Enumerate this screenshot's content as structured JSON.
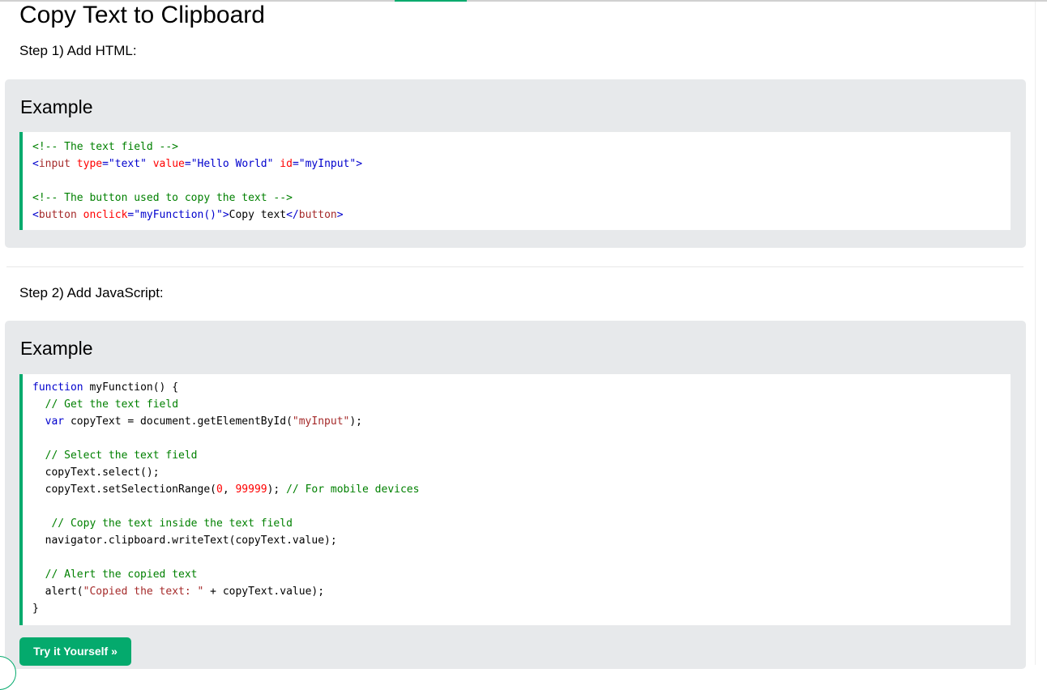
{
  "page": {
    "title": "Copy Text to Clipboard",
    "step1": "Step 1) Add HTML:",
    "step2": "Step 2) Add JavaScript:"
  },
  "examples": [
    {
      "title": "Example",
      "lines": [
        [
          {
            "t": "<!-- The text field -->",
            "c": "cmt"
          }
        ],
        [
          {
            "t": "<",
            "c": "tagb"
          },
          {
            "t": "input",
            "c": "tag"
          },
          {
            "t": " type",
            "c": "attr"
          },
          {
            "t": "=\"text\"",
            "c": "val"
          },
          {
            "t": " value",
            "c": "attr"
          },
          {
            "t": "=\"Hello World\"",
            "c": "val"
          },
          {
            "t": " id",
            "c": "attr"
          },
          {
            "t": "=\"myInput\"",
            "c": "val"
          },
          {
            "t": ">",
            "c": "tagb"
          }
        ],
        [],
        [
          {
            "t": "<!-- The button used to copy the text -->",
            "c": "cmt"
          }
        ],
        [
          {
            "t": "<",
            "c": "tagb"
          },
          {
            "t": "button",
            "c": "tag"
          },
          {
            "t": " onclick",
            "c": "attr"
          },
          {
            "t": "=\"myFunction()\"",
            "c": "val"
          },
          {
            "t": ">",
            "c": "tagb"
          },
          {
            "t": "Copy text",
            "c": ""
          },
          {
            "t": "</",
            "c": "tagb"
          },
          {
            "t": "button",
            "c": "tag"
          },
          {
            "t": ">",
            "c": "tagb"
          }
        ]
      ]
    },
    {
      "title": "Example",
      "lines": [
        [
          {
            "t": "function",
            "c": "kw"
          },
          {
            "t": " myFunction() {",
            "c": ""
          }
        ],
        [
          {
            "t": "  ",
            "c": ""
          },
          {
            "t": "// Get the text field",
            "c": "cmt"
          }
        ],
        [
          {
            "t": "  ",
            "c": ""
          },
          {
            "t": "var",
            "c": "kw"
          },
          {
            "t": " copyText = document.getElementById(",
            "c": ""
          },
          {
            "t": "\"myInput\"",
            "c": "str"
          },
          {
            "t": ");",
            "c": ""
          }
        ],
        [],
        [
          {
            "t": "  ",
            "c": ""
          },
          {
            "t": "// Select the text field",
            "c": "cmt"
          }
        ],
        [
          {
            "t": "  copyText.select();",
            "c": ""
          }
        ],
        [
          {
            "t": "  copyText.setSelectionRange(",
            "c": ""
          },
          {
            "t": "0",
            "c": "num"
          },
          {
            "t": ", ",
            "c": ""
          },
          {
            "t": "99999",
            "c": "num"
          },
          {
            "t": "); ",
            "c": ""
          },
          {
            "t": "// For mobile devices",
            "c": "cmt"
          }
        ],
        [],
        [
          {
            "t": "   ",
            "c": ""
          },
          {
            "t": "// Copy the text inside the text field",
            "c": "cmt"
          }
        ],
        [
          {
            "t": "  navigator.clipboard.writeText(copyText.value);",
            "c": ""
          }
        ],
        [],
        [
          {
            "t": "  ",
            "c": ""
          },
          {
            "t": "// Alert the copied text",
            "c": "cmt"
          }
        ],
        [
          {
            "t": "  alert(",
            "c": ""
          },
          {
            "t": "\"Copied the text: \"",
            "c": "str"
          },
          {
            "t": " + copyText.value);",
            "c": ""
          }
        ],
        [
          {
            "t": "}",
            "c": ""
          }
        ]
      ],
      "button": "Try it Yourself »"
    }
  ],
  "colors": {
    "accent": "#04aa6d",
    "panel": "#e7e9eb",
    "comment": "#008000",
    "keyword": "#0000cd",
    "string": "#a52a2a",
    "number": "#ff0000"
  }
}
